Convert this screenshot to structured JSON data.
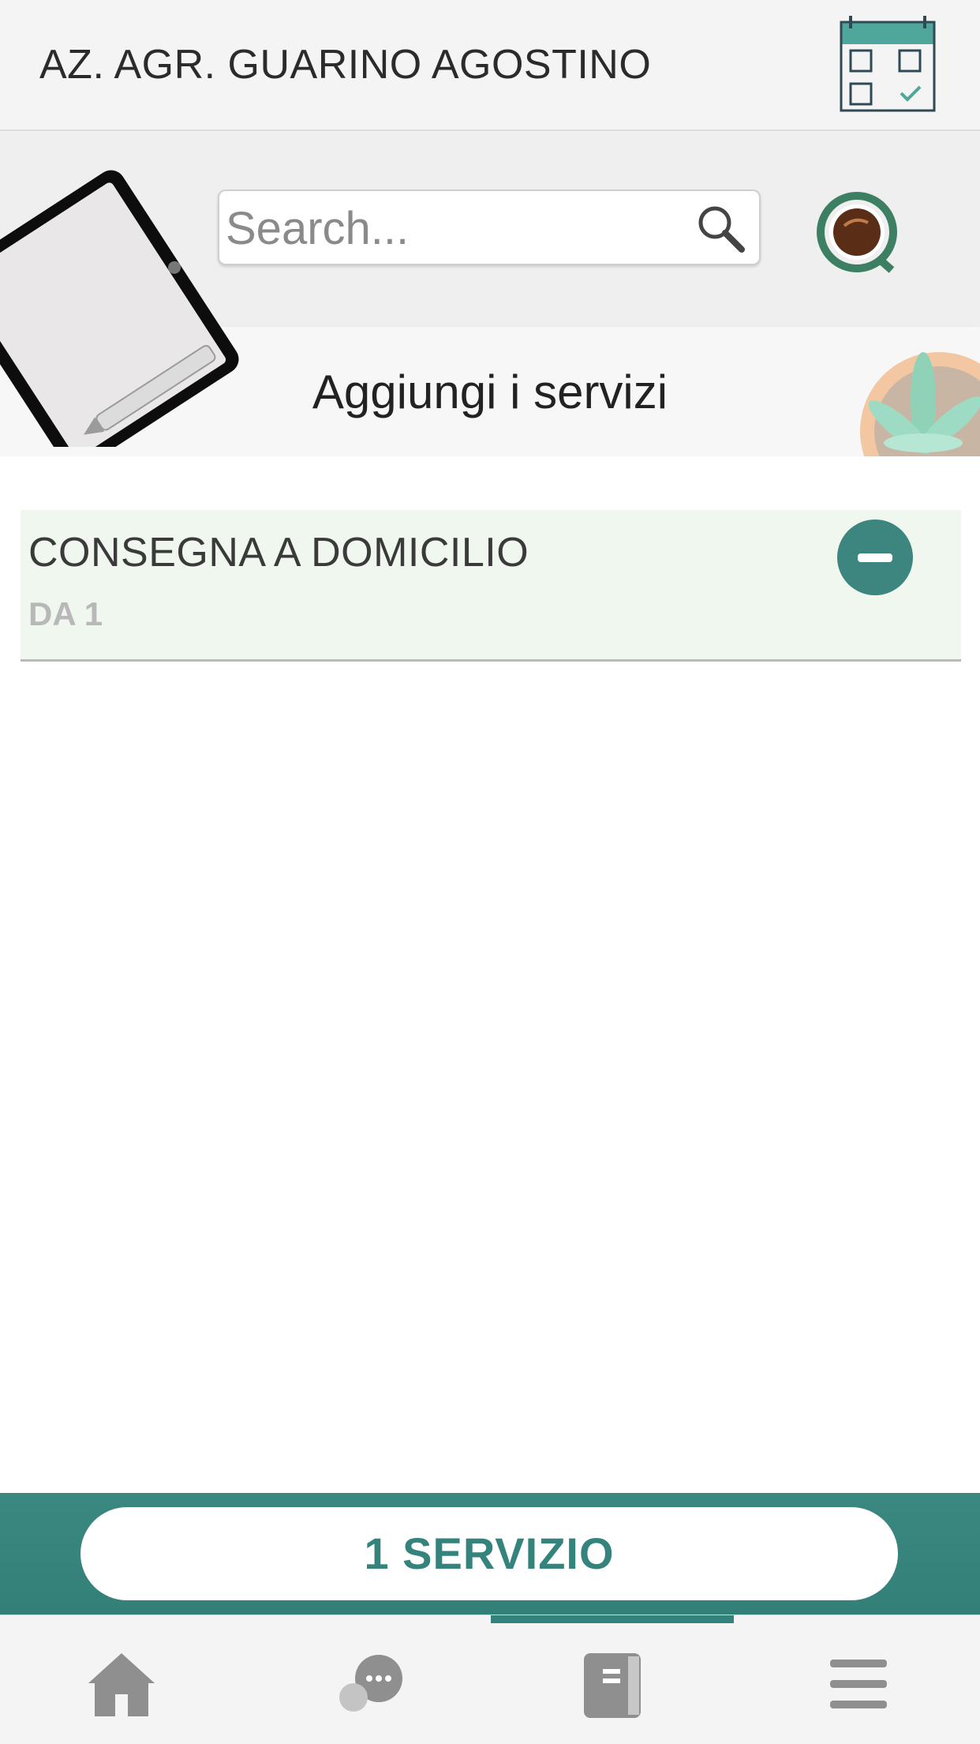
{
  "header": {
    "title": "AZ. AGR. GUARINO AGOSTINO",
    "calendar_icon": "calendar-check-icon"
  },
  "search": {
    "placeholder": "Search..."
  },
  "banner": {
    "title": "Aggiungi i servizi"
  },
  "services": [
    {
      "name": "CONSEGNA A DOMICILIO",
      "subtitle": "DA 1",
      "action_icon": "minus-icon"
    }
  ],
  "cart": {
    "label": "1 SERVIZIO"
  },
  "tabs": [
    {
      "icon": "home-icon"
    },
    {
      "icon": "chat-icon"
    },
    {
      "icon": "book-icon",
      "active": true
    },
    {
      "icon": "menu-icon"
    }
  ],
  "colors": {
    "accent": "#3d8680",
    "row_bg": "#eff7ef",
    "header_bg": "#f4f4f4"
  }
}
